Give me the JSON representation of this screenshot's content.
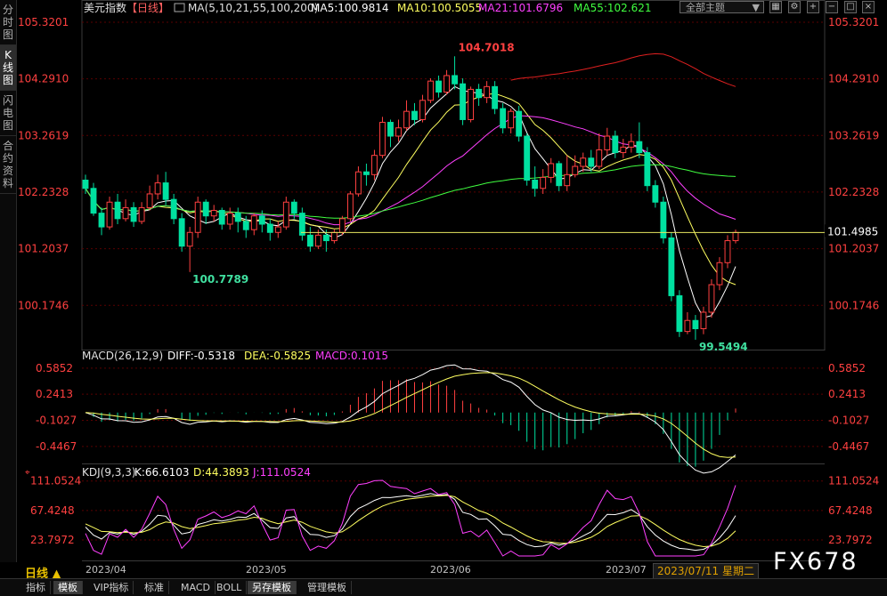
{
  "left_tabs": [
    "分时图",
    "K线图",
    "闪电图",
    "合约资料"
  ],
  "header": {
    "symbol": "美元指数",
    "period": "【日线】",
    "ma_params": "MA(5,10,21,55,100,200)",
    "ma5": "MA5:100.9814",
    "ma10": "MA10:100.5055",
    "ma21": "MA21:101.6796",
    "ma55": "MA55:102.621"
  },
  "toolbar": {
    "theme": "全部主题",
    "theme_arrow": "▼"
  },
  "price_axis": [
    "105.3201",
    "104.2910",
    "103.2619",
    "102.2328",
    "101.2037",
    "100.1746"
  ],
  "current_price": "101.4985",
  "high_label": "104.7018",
  "low_label": "100.7789",
  "low2_label": "99.5494",
  "macd": {
    "title": "MACD(26,12,9)",
    "diff": "DIFF:-0.5318",
    "dea": "DEA:-0.5825",
    "macd": "MACD:0.1015",
    "axis": [
      "0.5852",
      "0.2413",
      "-0.1027",
      "-0.4467"
    ]
  },
  "kdj": {
    "title": "KDJ(9,3,3)",
    "k": "K:66.6103",
    "d": "D:44.3893",
    "j": "J:111.0524",
    "axis": [
      "111.0524",
      "67.4248",
      "23.7972"
    ]
  },
  "dates": [
    "2023/04",
    "2023/05",
    "2023/06",
    "2023/07"
  ],
  "timeline": "日线 ▲",
  "cursor_date": "2023/07/11 星期二",
  "brand": "FX678",
  "bottom_tabs": [
    "指标",
    "模板",
    "VIP指标",
    "标准",
    "MACD",
    "BOLL",
    "另存模板",
    "管理模板"
  ],
  "colors": {
    "up": "#ff4040",
    "down": "#00e0a0",
    "ma5": "#ffffff",
    "ma10": "#ffff60",
    "ma21": "#ff40ff",
    "ma55": "#40ff40"
  },
  "chart_data": {
    "type": "candlestick",
    "ohlc": [
      [
        102.45,
        102.3,
        102.55,
        102.2
      ],
      [
        102.3,
        101.85,
        102.4,
        101.8
      ],
      [
        101.85,
        101.6,
        101.95,
        101.45
      ],
      [
        101.6,
        102.05,
        102.15,
        101.55
      ],
      [
        102.05,
        101.75,
        102.2,
        101.65
      ],
      [
        101.75,
        101.95,
        102.1,
        101.7
      ],
      [
        101.95,
        101.7,
        102.05,
        101.6
      ],
      [
        101.7,
        101.95,
        102.05,
        101.65
      ],
      [
        101.95,
        102.2,
        102.35,
        101.9
      ],
      [
        102.2,
        102.4,
        102.55,
        102.1
      ],
      [
        102.4,
        102.1,
        102.6,
        102.0
      ],
      [
        102.1,
        101.75,
        102.2,
        101.65
      ],
      [
        101.75,
        101.25,
        101.85,
        101.15
      ],
      [
        101.25,
        101.5,
        101.6,
        100.78
      ],
      [
        101.5,
        102.05,
        102.15,
        101.4
      ],
      [
        102.05,
        101.8,
        102.1,
        101.65
      ],
      [
        101.8,
        101.9,
        102.0,
        101.7
      ],
      [
        101.9,
        101.65,
        101.95,
        101.55
      ],
      [
        101.65,
        101.85,
        101.95,
        101.55
      ],
      [
        101.85,
        101.7,
        101.95,
        101.5
      ],
      [
        101.7,
        101.55,
        101.8,
        101.4
      ],
      [
        101.55,
        101.8,
        101.85,
        101.45
      ],
      [
        101.8,
        101.65,
        101.9,
        101.5
      ],
      [
        101.65,
        101.5,
        101.75,
        101.35
      ],
      [
        101.5,
        101.6,
        101.7,
        101.4
      ],
      [
        101.6,
        102.05,
        102.15,
        101.55
      ],
      [
        102.05,
        101.85,
        102.1,
        101.75
      ],
      [
        101.85,
        101.45,
        101.95,
        101.35
      ],
      [
        101.45,
        101.25,
        101.6,
        101.15
      ],
      [
        101.25,
        101.45,
        101.55,
        101.2
      ],
      [
        101.45,
        101.35,
        101.55,
        101.15
      ],
      [
        101.35,
        101.5,
        101.55,
        101.3
      ],
      [
        101.5,
        101.75,
        101.8,
        101.45
      ],
      [
        101.75,
        102.2,
        102.25,
        101.7
      ],
      [
        102.2,
        102.6,
        102.7,
        102.15
      ],
      [
        102.6,
        102.55,
        102.75,
        102.35
      ],
      [
        102.55,
        102.9,
        103.0,
        102.45
      ],
      [
        102.9,
        103.5,
        103.6,
        102.85
      ],
      [
        103.5,
        103.25,
        103.55,
        103.05
      ],
      [
        103.25,
        103.4,
        103.55,
        103.15
      ],
      [
        103.4,
        103.7,
        103.9,
        103.35
      ],
      [
        103.7,
        103.55,
        103.85,
        103.45
      ],
      [
        103.55,
        103.9,
        104.0,
        103.5
      ],
      [
        103.9,
        104.25,
        104.3,
        103.85
      ],
      [
        104.25,
        104.05,
        104.35,
        103.95
      ],
      [
        104.05,
        104.35,
        104.45,
        104.0
      ],
      [
        104.35,
        104.2,
        104.7,
        104.1
      ],
      [
        104.2,
        103.55,
        104.3,
        103.45
      ],
      [
        103.55,
        104.1,
        104.15,
        103.5
      ],
      [
        104.1,
        103.95,
        104.2,
        103.8
      ],
      [
        103.95,
        104.15,
        104.25,
        103.85
      ],
      [
        104.15,
        103.75,
        104.25,
        103.65
      ],
      [
        103.75,
        103.4,
        103.85,
        103.3
      ],
      [
        103.4,
        103.7,
        103.75,
        103.3
      ],
      [
        103.7,
        103.25,
        103.8,
        103.15
      ],
      [
        103.25,
        102.45,
        103.3,
        102.35
      ],
      [
        102.45,
        102.3,
        102.7,
        102.15
      ],
      [
        102.3,
        102.5,
        102.65,
        102.2
      ],
      [
        102.5,
        102.75,
        102.85,
        102.4
      ],
      [
        102.75,
        102.35,
        102.8,
        102.25
      ],
      [
        102.35,
        102.55,
        102.9,
        102.25
      ],
      [
        102.55,
        102.7,
        102.9,
        102.5
      ],
      [
        102.7,
        102.85,
        102.95,
        102.6
      ],
      [
        102.85,
        102.7,
        103.0,
        102.6
      ],
      [
        102.7,
        103.0,
        103.3,
        102.65
      ],
      [
        103.0,
        103.25,
        103.4,
        102.9
      ],
      [
        103.25,
        102.95,
        103.35,
        102.85
      ],
      [
        102.95,
        103.05,
        103.2,
        102.85
      ],
      [
        103.05,
        103.15,
        103.3,
        102.95
      ],
      [
        103.15,
        102.95,
        103.5,
        102.85
      ],
      [
        102.95,
        102.35,
        103.05,
        102.25
      ],
      [
        102.35,
        102.05,
        102.45,
        101.95
      ],
      [
        102.05,
        101.4,
        102.15,
        101.3
      ],
      [
        101.4,
        100.35,
        101.5,
        100.25
      ],
      [
        100.35,
        99.7,
        100.45,
        99.6
      ],
      [
        99.7,
        99.9,
        100.05,
        99.65
      ],
      [
        99.9,
        99.75,
        100.0,
        99.55
      ],
      [
        99.75,
        100.05,
        100.15,
        99.65
      ],
      [
        100.05,
        100.55,
        100.65,
        99.95
      ],
      [
        100.55,
        100.95,
        101.05,
        100.45
      ],
      [
        100.95,
        101.35,
        101.45,
        100.85
      ],
      [
        101.35,
        101.5,
        101.55,
        101.3
      ]
    ],
    "price_range": [
      99.5,
      105.4
    ],
    "macd_range": [
      -0.6,
      0.63
    ],
    "kdj_range": [
      0,
      112
    ],
    "x_categories": [
      "2023/04",
      "2023/05",
      "2023/06",
      "2023/07"
    ]
  }
}
